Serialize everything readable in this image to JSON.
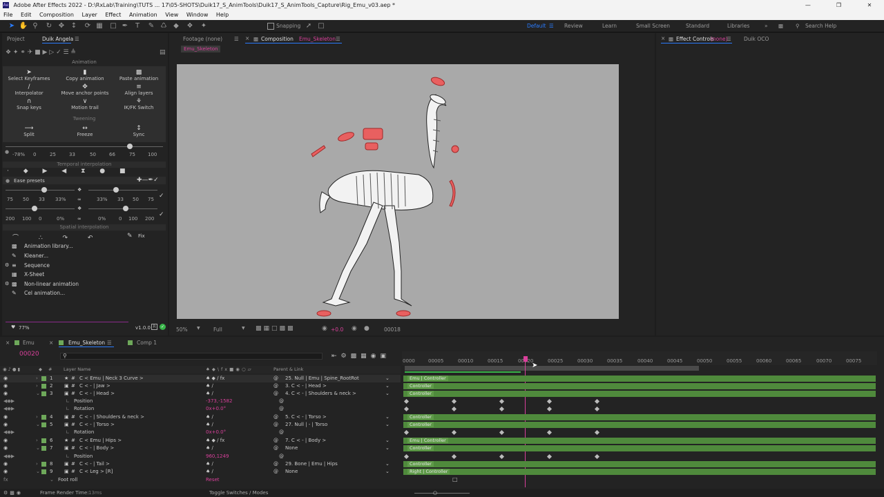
{
  "app": {
    "title": "Adobe After Effects 2022 - D:\\RxLab\\Training\\TUTS ... 17\\05-SHOTS\\Duik17_S_AnimTools\\Duik17_S_AnimTools_Capture\\Rig_Emu_v03.aep *",
    "menu": [
      "File",
      "Edit",
      "Composition",
      "Layer",
      "Effect",
      "Animation",
      "View",
      "Window",
      "Help"
    ],
    "accent": "#2a7cff",
    "highlight": "#d9409b"
  },
  "toolbar": {
    "snapping": "Snapping",
    "workspaces": [
      "Default",
      "Review",
      "Learn",
      "Small Screen",
      "Standard",
      "Libraries"
    ],
    "search_help": "Search Help"
  },
  "left_panel": {
    "tabs": [
      "Project",
      "Duik Angela"
    ],
    "animation_header": "Animation",
    "tools": [
      "Select Keyframes",
      "Copy animation",
      "Paste animation",
      "Interpolator",
      "Move anchor points",
      "Align layers",
      "Snap keys",
      "Motion trail",
      "IK/FK Switch"
    ],
    "tweening_header": "Tweening",
    "tweening": [
      "Split",
      "Freeze",
      "Sync"
    ],
    "tween_scale": [
      "-78%",
      "0",
      "25",
      "33",
      "50",
      "66",
      "75",
      "100"
    ],
    "temporal_header": "Temporal interpolation",
    "ease_presets": "Ease presets",
    "ease_row1": [
      "75",
      "50",
      "33",
      "33%",
      "33%",
      "33",
      "50",
      "75"
    ],
    "ease_row2": [
      "200",
      "100",
      "0",
      "0%",
      "0%",
      "0",
      "100",
      "200"
    ],
    "spatial_header": "Spatial interpolation",
    "fix": "Fix",
    "libraries": [
      "Animation library...",
      "Kleaner...",
      "Sequence",
      "X-Sheet",
      "Non-linear animation",
      "Cel animation..."
    ],
    "footer_zoom": "77%",
    "version": "v1.0.0"
  },
  "comp_panel": {
    "footage_tab": "Footage (none)",
    "comp_tab": "Composition",
    "comp_name": "Emu_Skeleton",
    "breadcrumb": "Emu_Skeleton",
    "zoom": "50%",
    "resolution": "Full",
    "exposure": "+0.0",
    "timecode": "00018"
  },
  "effects_panel": {
    "tab": "Effect Controls",
    "tab_target": "(none)",
    "tab2": "Duik OCO"
  },
  "timeline": {
    "tabs": [
      "Emu",
      "Emu_Skeleton",
      "Comp 1"
    ],
    "current_time": "00020",
    "col_layer_name": "Layer Name",
    "col_parent": "Parent & Link",
    "ruler": [
      "0000",
      "00005",
      "00010",
      "00015",
      "00020",
      "00025",
      "00030",
      "00035",
      "00040",
      "00045",
      "00050",
      "00055",
      "00060",
      "00065",
      "00070",
      "00075"
    ],
    "rows": [
      {
        "num": "1",
        "name": "C < Emu | Neck 3 Curve >",
        "parent": "25. Null | Emu | Spine_RootRot",
        "bar": "Emu | Controller"
      },
      {
        "num": "2",
        "name": "C < - | Jaw >",
        "parent": "3. C < - | Head >",
        "bar": "Controller"
      },
      {
        "num": "3",
        "name": "C < - | Head >",
        "parent": "4. C < - | Shoulders & neck >",
        "bar": "Controller"
      },
      {
        "num": "",
        "name": "Position",
        "parent": "",
        "value": "-373,-1582"
      },
      {
        "num": "",
        "name": "Rotation",
        "parent": "",
        "value": "0x+0.0°"
      },
      {
        "num": "4",
        "name": "C < - | Shoulders & neck >",
        "parent": "5. C < - | Torso >",
        "bar": "Controller"
      },
      {
        "num": "5",
        "name": "C < - | Torso >",
        "parent": "27. Null | - | Torso",
        "bar": "Controller"
      },
      {
        "num": "",
        "name": "Rotation",
        "parent": "",
        "value": "0x+0.0°"
      },
      {
        "num": "6",
        "name": "C < Emu | Hips >",
        "parent": "7. C < - | Body >",
        "bar": "Emu | Controller"
      },
      {
        "num": "7",
        "name": "C < - | Body >",
        "parent": "None",
        "bar": "Controller"
      },
      {
        "num": "",
        "name": "Position",
        "parent": "",
        "value": "960,1249"
      },
      {
        "num": "8",
        "name": "C < - | Tail >",
        "parent": "29. Bone | Emu | Hips",
        "bar": "Controller"
      },
      {
        "num": "9",
        "name": "C < Leg > [R]",
        "parent": "None",
        "bar": "Right | Controller"
      },
      {
        "num": "",
        "name": "Foot roll",
        "parent": "",
        "value": "Reset"
      }
    ],
    "footer_render": "Frame Render Time:",
    "footer_render_value": "13ms",
    "footer_toggle": "Toggle Switches / Modes"
  }
}
